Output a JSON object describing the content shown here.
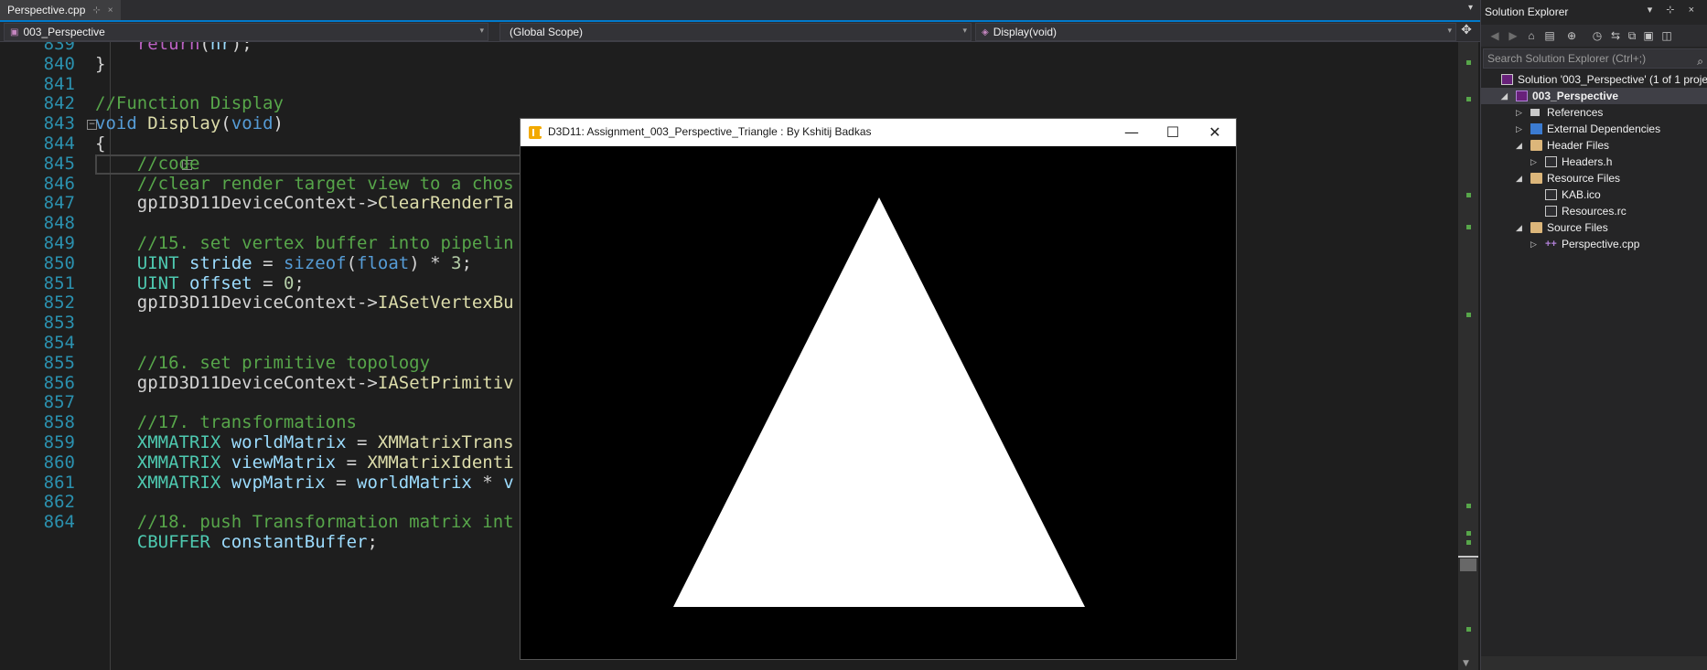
{
  "editor": {
    "tab": {
      "label": "Perspective.cpp",
      "pin": "⊹",
      "close": "×"
    },
    "nav": {
      "project": "003_Perspective",
      "scope": "(Global Scope)",
      "member": "Display(void)"
    },
    "lines": [
      {
        "n": "839",
        "tokens": [
          {
            "t": "    ",
            "c": "pl"
          },
          {
            "t": "return",
            "c": "mc"
          },
          {
            "t": "(",
            "c": "pl"
          },
          {
            "t": "hr",
            "c": "va"
          },
          {
            "t": ");",
            "c": "pl"
          }
        ]
      },
      {
        "n": "840",
        "tokens": [
          {
            "t": "}",
            "c": "pl"
          }
        ]
      },
      {
        "n": "841",
        "tokens": []
      },
      {
        "n": "842",
        "tokens": [
          {
            "t": "//Function Display",
            "c": "cm"
          }
        ]
      },
      {
        "n": "843",
        "fold": "-",
        "tokens": [
          {
            "t": "void",
            "c": "kw"
          },
          {
            "t": " ",
            "c": "pl"
          },
          {
            "t": "Display",
            "c": "fn"
          },
          {
            "t": "(",
            "c": "pl"
          },
          {
            "t": "void",
            "c": "kw"
          },
          {
            "t": ")",
            "c": "pl"
          }
        ]
      },
      {
        "n": "844",
        "tokens": [
          {
            "t": "{",
            "c": "pl"
          }
        ]
      },
      {
        "n": "845",
        "fold": "-",
        "tokens": [
          {
            "t": "    ",
            "c": "pl"
          },
          {
            "t": "//code",
            "c": "cm"
          }
        ]
      },
      {
        "n": "846",
        "tokens": [
          {
            "t": "    ",
            "c": "pl"
          },
          {
            "t": "//clear render target view to a chos",
            "c": "cm"
          }
        ]
      },
      {
        "n": "847",
        "tokens": [
          {
            "t": "    ",
            "c": "pl"
          },
          {
            "t": "gpID3D11DeviceContext",
            "c": "pl"
          },
          {
            "t": "->",
            "c": "pl"
          },
          {
            "t": "ClearRenderTa",
            "c": "fn"
          }
        ]
      },
      {
        "n": "848",
        "tokens": []
      },
      {
        "n": "849",
        "tokens": [
          {
            "t": "    ",
            "c": "pl"
          },
          {
            "t": "//15. set vertex buffer into pipelin",
            "c": "cm"
          }
        ]
      },
      {
        "n": "850",
        "tokens": [
          {
            "t": "    ",
            "c": "pl"
          },
          {
            "t": "UINT",
            "c": "ty"
          },
          {
            "t": " ",
            "c": "pl"
          },
          {
            "t": "stride",
            "c": "va"
          },
          {
            "t": " = ",
            "c": "pl"
          },
          {
            "t": "sizeof",
            "c": "kw"
          },
          {
            "t": "(",
            "c": "pl"
          },
          {
            "t": "float",
            "c": "kw"
          },
          {
            "t": ") * ",
            "c": "pl"
          },
          {
            "t": "3",
            "c": "nm"
          },
          {
            "t": ";",
            "c": "pl"
          }
        ]
      },
      {
        "n": "851",
        "tokens": [
          {
            "t": "    ",
            "c": "pl"
          },
          {
            "t": "UINT",
            "c": "ty"
          },
          {
            "t": " ",
            "c": "pl"
          },
          {
            "t": "offset",
            "c": "va"
          },
          {
            "t": " = ",
            "c": "pl"
          },
          {
            "t": "0",
            "c": "nm"
          },
          {
            "t": ";",
            "c": "pl"
          }
        ]
      },
      {
        "n": "852",
        "tokens": [
          {
            "t": "    ",
            "c": "pl"
          },
          {
            "t": "gpID3D11DeviceContext",
            "c": "pl"
          },
          {
            "t": "->",
            "c": "pl"
          },
          {
            "t": "IASetVertexBu",
            "c": "fn"
          }
        ]
      },
      {
        "n": "853",
        "tokens": []
      },
      {
        "n": "854",
        "tokens": []
      },
      {
        "n": "855",
        "tokens": [
          {
            "t": "    ",
            "c": "pl"
          },
          {
            "t": "//16. set primitive topology",
            "c": "cm"
          }
        ]
      },
      {
        "n": "856",
        "tokens": [
          {
            "t": "    ",
            "c": "pl"
          },
          {
            "t": "gpID3D11DeviceContext",
            "c": "pl"
          },
          {
            "t": "->",
            "c": "pl"
          },
          {
            "t": "IASetPrimitiv",
            "c": "fn"
          }
        ]
      },
      {
        "n": "857",
        "tokens": []
      },
      {
        "n": "858",
        "tokens": [
          {
            "t": "    ",
            "c": "pl"
          },
          {
            "t": "//17. transformations",
            "c": "cm"
          }
        ]
      },
      {
        "n": "859",
        "tokens": [
          {
            "t": "    ",
            "c": "pl"
          },
          {
            "t": "XMMATRIX",
            "c": "ty"
          },
          {
            "t": " ",
            "c": "pl"
          },
          {
            "t": "worldMatrix",
            "c": "va"
          },
          {
            "t": " = ",
            "c": "pl"
          },
          {
            "t": "XMMatrixTrans",
            "c": "fn"
          }
        ]
      },
      {
        "n": "860",
        "tokens": [
          {
            "t": "    ",
            "c": "pl"
          },
          {
            "t": "XMMATRIX",
            "c": "ty"
          },
          {
            "t": " ",
            "c": "pl"
          },
          {
            "t": "viewMatrix",
            "c": "va"
          },
          {
            "t": " = ",
            "c": "pl"
          },
          {
            "t": "XMMatrixIdenti",
            "c": "fn"
          }
        ]
      },
      {
        "n": "861",
        "tokens": [
          {
            "t": "    ",
            "c": "pl"
          },
          {
            "t": "XMMATRIX",
            "c": "ty"
          },
          {
            "t": " ",
            "c": "pl"
          },
          {
            "t": "wvpMatrix",
            "c": "va"
          },
          {
            "t": " = ",
            "c": "pl"
          },
          {
            "t": "worldMatrix",
            "c": "va"
          },
          {
            "t": " * ",
            "c": "pl"
          },
          {
            "t": "v",
            "c": "va"
          }
        ]
      },
      {
        "n": "862",
        "tokens": []
      },
      {
        "n": "864",
        "tokens": [
          {
            "t": "    ",
            "c": "pl"
          },
          {
            "t": "//18. push Transformation matrix int",
            "c": "cm"
          }
        ]
      },
      {
        "n": "",
        "tokens": [
          {
            "t": "    ",
            "c": "pl"
          },
          {
            "t": "CBUFFER",
            "c": "ty"
          },
          {
            "t": " ",
            "c": "pl"
          },
          {
            "t": "constantBuffer",
            "c": "va"
          },
          {
            "t": ";",
            "c": "pl"
          }
        ]
      }
    ]
  },
  "d3d_window": {
    "title": "D3D11: Assignment_003_Perspective_Triangle : By Kshitij Badkas",
    "minimize": "—",
    "maximize": "☐",
    "close": "✕",
    "background": "#000000",
    "triangle_color": "#ffffff"
  },
  "solution_explorer": {
    "title": "Solution Explorer",
    "title_buttons": "▾ ⊹ ×",
    "search_placeholder": "Search Solution Explorer (Ctrl+;)",
    "nodes": [
      {
        "label": "Solution '003_Perspective' (1 of 1 project",
        "icon": "sol",
        "depth": 0,
        "exp": ""
      },
      {
        "label": "003_Perspective",
        "icon": "proj",
        "depth": 1,
        "exp": "◢",
        "selected": true
      },
      {
        "label": "References",
        "icon": "ref",
        "depth": 2,
        "exp": "▷"
      },
      {
        "label": "External Dependencies",
        "icon": "ext",
        "depth": 2,
        "exp": "▷"
      },
      {
        "label": "Header Files",
        "icon": "folder",
        "depth": 2,
        "exp": "◢"
      },
      {
        "label": "Headers.h",
        "icon": "file",
        "depth": 3,
        "exp": "▷"
      },
      {
        "label": "Resource Files",
        "icon": "folder",
        "depth": 2,
        "exp": "◢"
      },
      {
        "label": "KAB.ico",
        "icon": "file",
        "depth": 3,
        "exp": ""
      },
      {
        "label": "Resources.rc",
        "icon": "file",
        "depth": 3,
        "exp": ""
      },
      {
        "label": "Source Files",
        "icon": "folder",
        "depth": 2,
        "exp": "◢"
      },
      {
        "label": "Perspective.cpp",
        "icon": "cpp",
        "depth": 3,
        "exp": "▷"
      }
    ]
  }
}
